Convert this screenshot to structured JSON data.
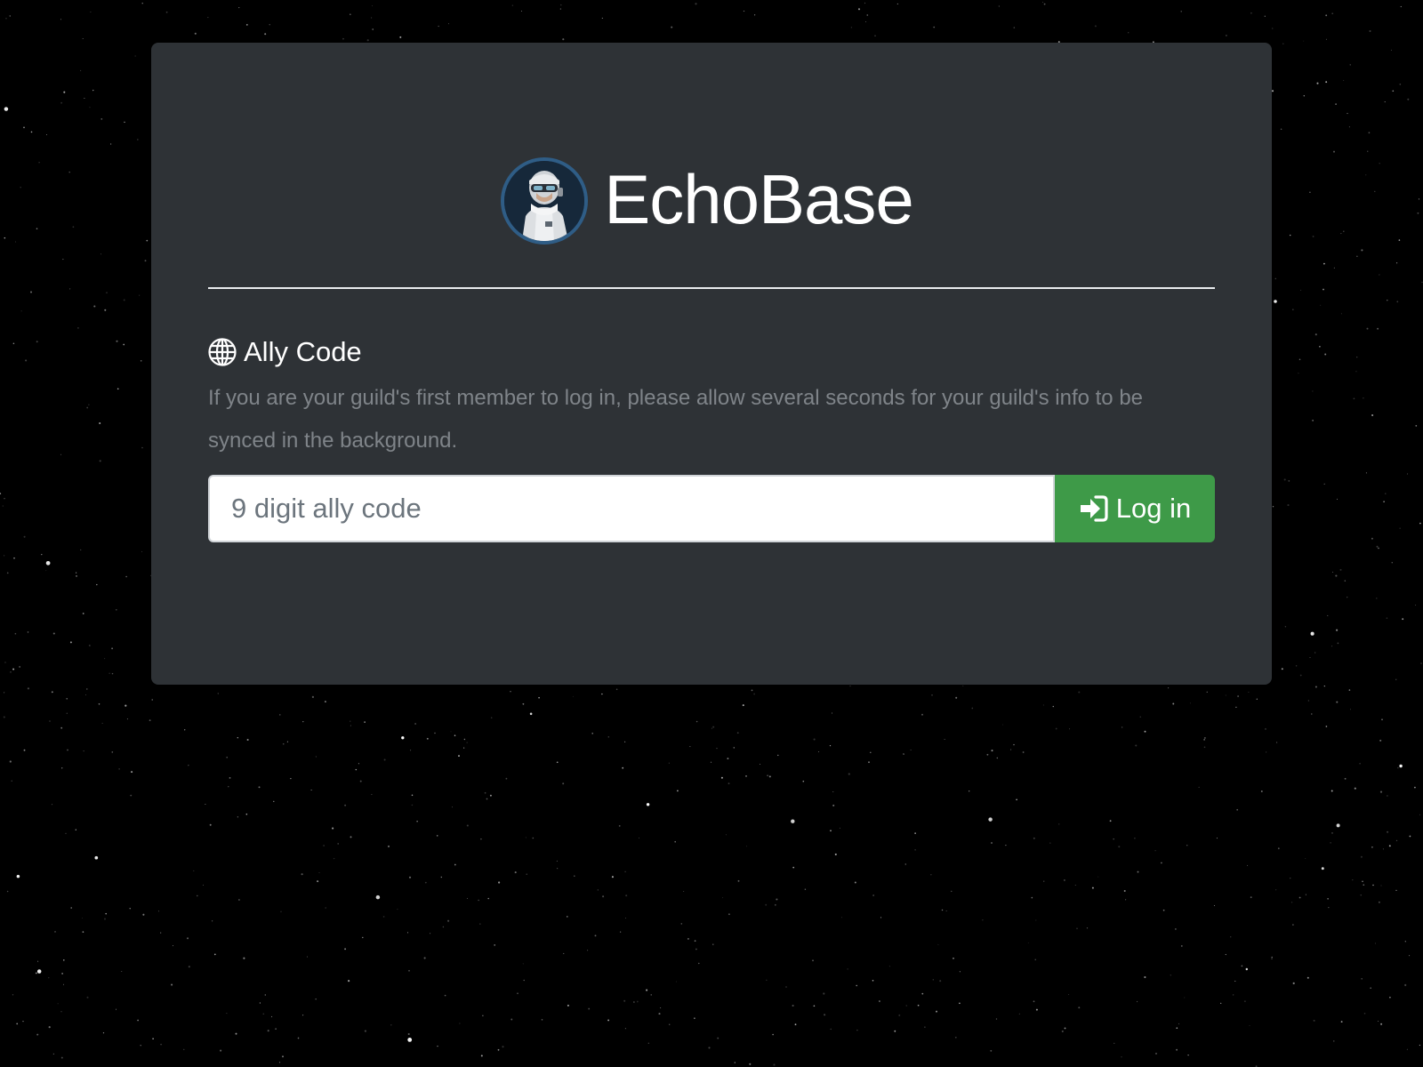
{
  "app": {
    "title": "EchoBase"
  },
  "login": {
    "section_title": "Ally Code",
    "help_text": "If you are your guild's first member to log in, please allow several seconds for your guild's info to be synced in the background.",
    "input_placeholder": "9 digit ally code",
    "input_value": "",
    "button_label": "Log in"
  },
  "icons": {
    "section": "globe-icon",
    "button": "sign-in-icon",
    "avatar": "trooper-avatar"
  },
  "colors": {
    "background": "#000000",
    "card": "#2e3236",
    "button": "#3e9a48",
    "help_text": "#7f8489",
    "avatar_ring": "#2f5d86"
  }
}
